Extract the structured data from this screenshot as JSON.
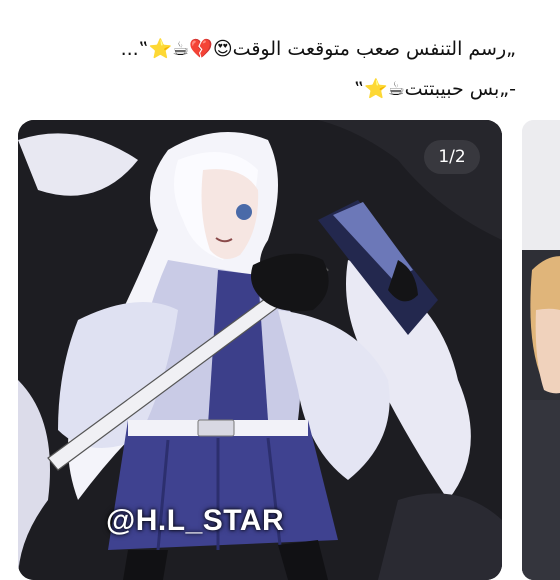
{
  "post": {
    "caption_line1": "„رسم التنفس صعب متوقعت الوقت😍💔☕⭐‟...",
    "caption_line2": "-„بس حبيبتتت☕⭐‟",
    "page_indicator": "1/2",
    "watermark": "@H.L_STAR"
  },
  "colors": {
    "background": "#ffffff",
    "badge": "#3c3c42",
    "image_dark": "#1d1d22"
  }
}
